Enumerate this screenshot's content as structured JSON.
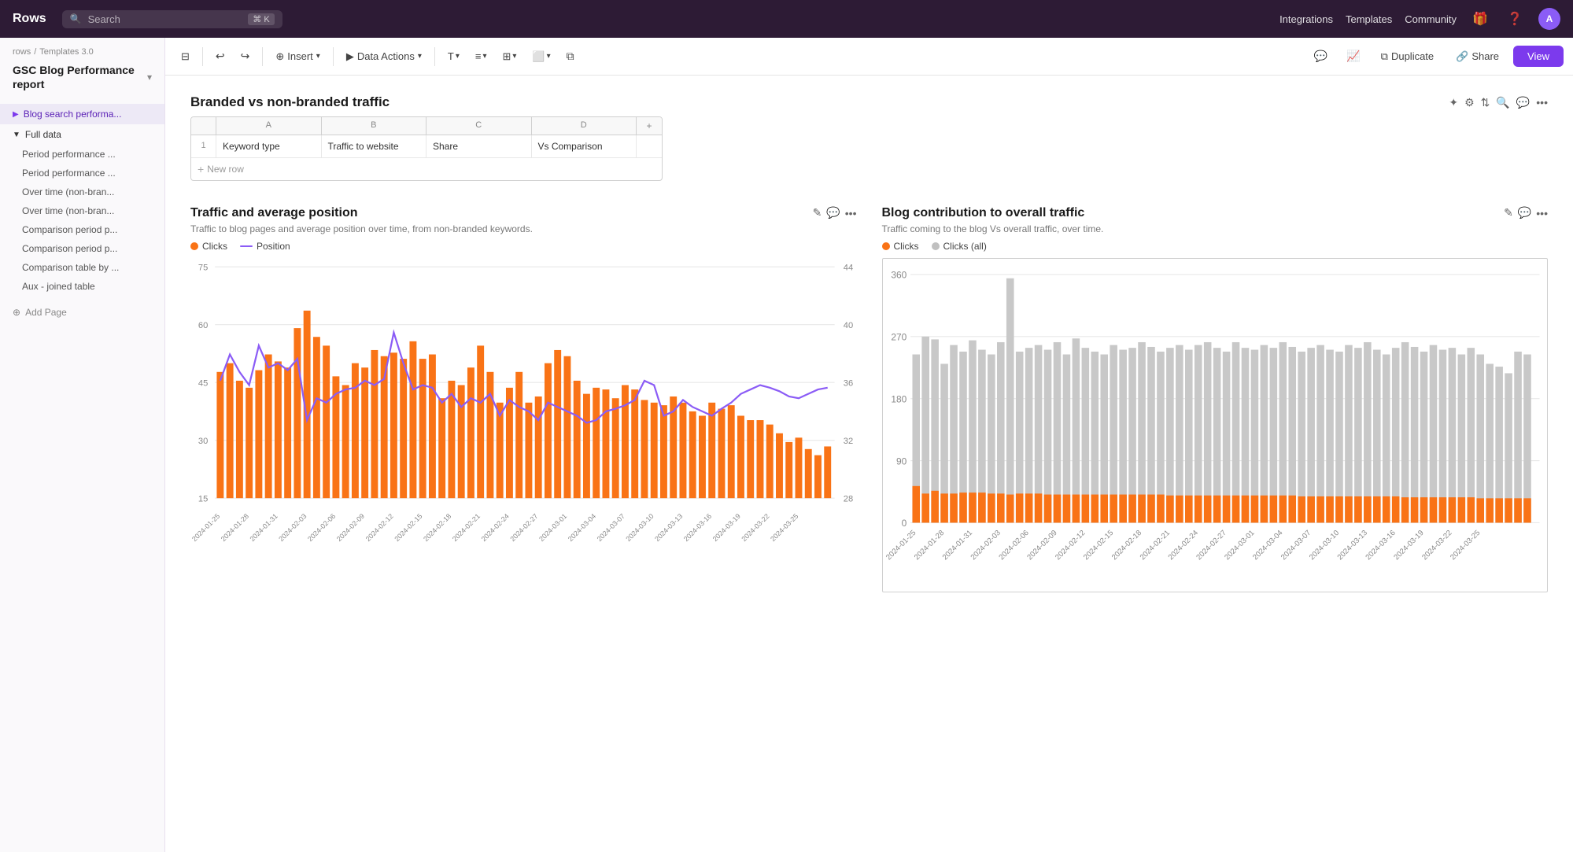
{
  "app": {
    "logo": "Rows",
    "search_placeholder": "Search",
    "search_kbd": "⌘ K"
  },
  "nav": {
    "integrations": "Integrations",
    "templates": "Templates",
    "community": "Community",
    "avatar_initials": "A"
  },
  "toolbar": {
    "insert_label": "Insert",
    "data_actions_label": "Data Actions",
    "duplicate_label": "Duplicate",
    "share_label": "Share",
    "view_label": "View"
  },
  "breadcrumb": {
    "parent": "rows",
    "current": "Templates 3.0"
  },
  "sidebar": {
    "title": "GSC Blog Performance report",
    "sections": [
      {
        "id": "blog-search",
        "label": "Blog search performa...",
        "type": "item-active"
      },
      {
        "id": "full-data",
        "label": "Full data",
        "type": "section-open",
        "items": [
          "Period performance ...",
          "Period performance ...",
          "Over time (non-bran...",
          "Over time (non-bran...",
          "Comparison period p...",
          "Comparison period p...",
          "Comparison table by ...",
          "Aux - joined table"
        ]
      },
      {
        "id": "add-page",
        "label": "Add Page",
        "type": "add"
      }
    ]
  },
  "table_section": {
    "title": "Branded vs non-branded traffic",
    "columns": [
      "A",
      "B",
      "C",
      "D"
    ],
    "col_headers": [
      "Keyword type",
      "Traffic to website",
      "Share",
      "Vs Comparison"
    ],
    "new_row_label": "+ New row"
  },
  "chart_left": {
    "title": "Traffic and average position",
    "subtitle": "Traffic to blog pages and average position over time, from non-branded keywords.",
    "legend": [
      {
        "id": "clicks",
        "label": "Clicks",
        "type": "bar",
        "color": "#f97316"
      },
      {
        "id": "position",
        "label": "Position",
        "type": "line",
        "color": "#8b5cf6"
      }
    ],
    "y_left_labels": [
      "75",
      "60",
      "45",
      "30",
      "15"
    ],
    "y_right_labels": [
      "44",
      "40",
      "36",
      "32",
      "28"
    ],
    "x_labels": [
      "2024-01-25",
      "2024-01-28",
      "2024-01-31",
      "2024-02-03",
      "2024-02-06",
      "2024-02-09",
      "2024-02-12",
      "2024-02-15",
      "2024-02-18",
      "2024-02-21",
      "2024-02-24",
      "2024-02-27",
      "2024-03-01",
      "2024-03-04",
      "2024-03-07",
      "2024-03-10",
      "2024-03-13",
      "2024-03-16",
      "2024-03-19",
      "2024-03-22",
      "2024-03-25"
    ]
  },
  "chart_right": {
    "title": "Blog contribution to overall traffic",
    "subtitle": "Traffic coming to the blog Vs overall traffic, over time.",
    "legend": [
      {
        "id": "clicks",
        "label": "Clicks",
        "type": "bar",
        "color": "#f97316"
      },
      {
        "id": "clicks_all",
        "label": "Clicks (all)",
        "type": "bar",
        "color": "#c0c0c0"
      }
    ],
    "y_labels": [
      "360",
      "270",
      "180",
      "90",
      "0"
    ],
    "x_labels": [
      "2024-01-25",
      "2024-01-28",
      "2024-01-31",
      "2024-02-03",
      "2024-02-06",
      "2024-02-09",
      "2024-02-12",
      "2024-02-15",
      "2024-02-18",
      "2024-02-21",
      "2024-02-24",
      "2024-02-27",
      "2024-03-01",
      "2024-03-04",
      "2024-03-07",
      "2024-03-10",
      "2024-03-13",
      "2024-03-16",
      "2024-03-19",
      "2024-03-22",
      "2024-03-25",
      "2024-03-25"
    ]
  }
}
